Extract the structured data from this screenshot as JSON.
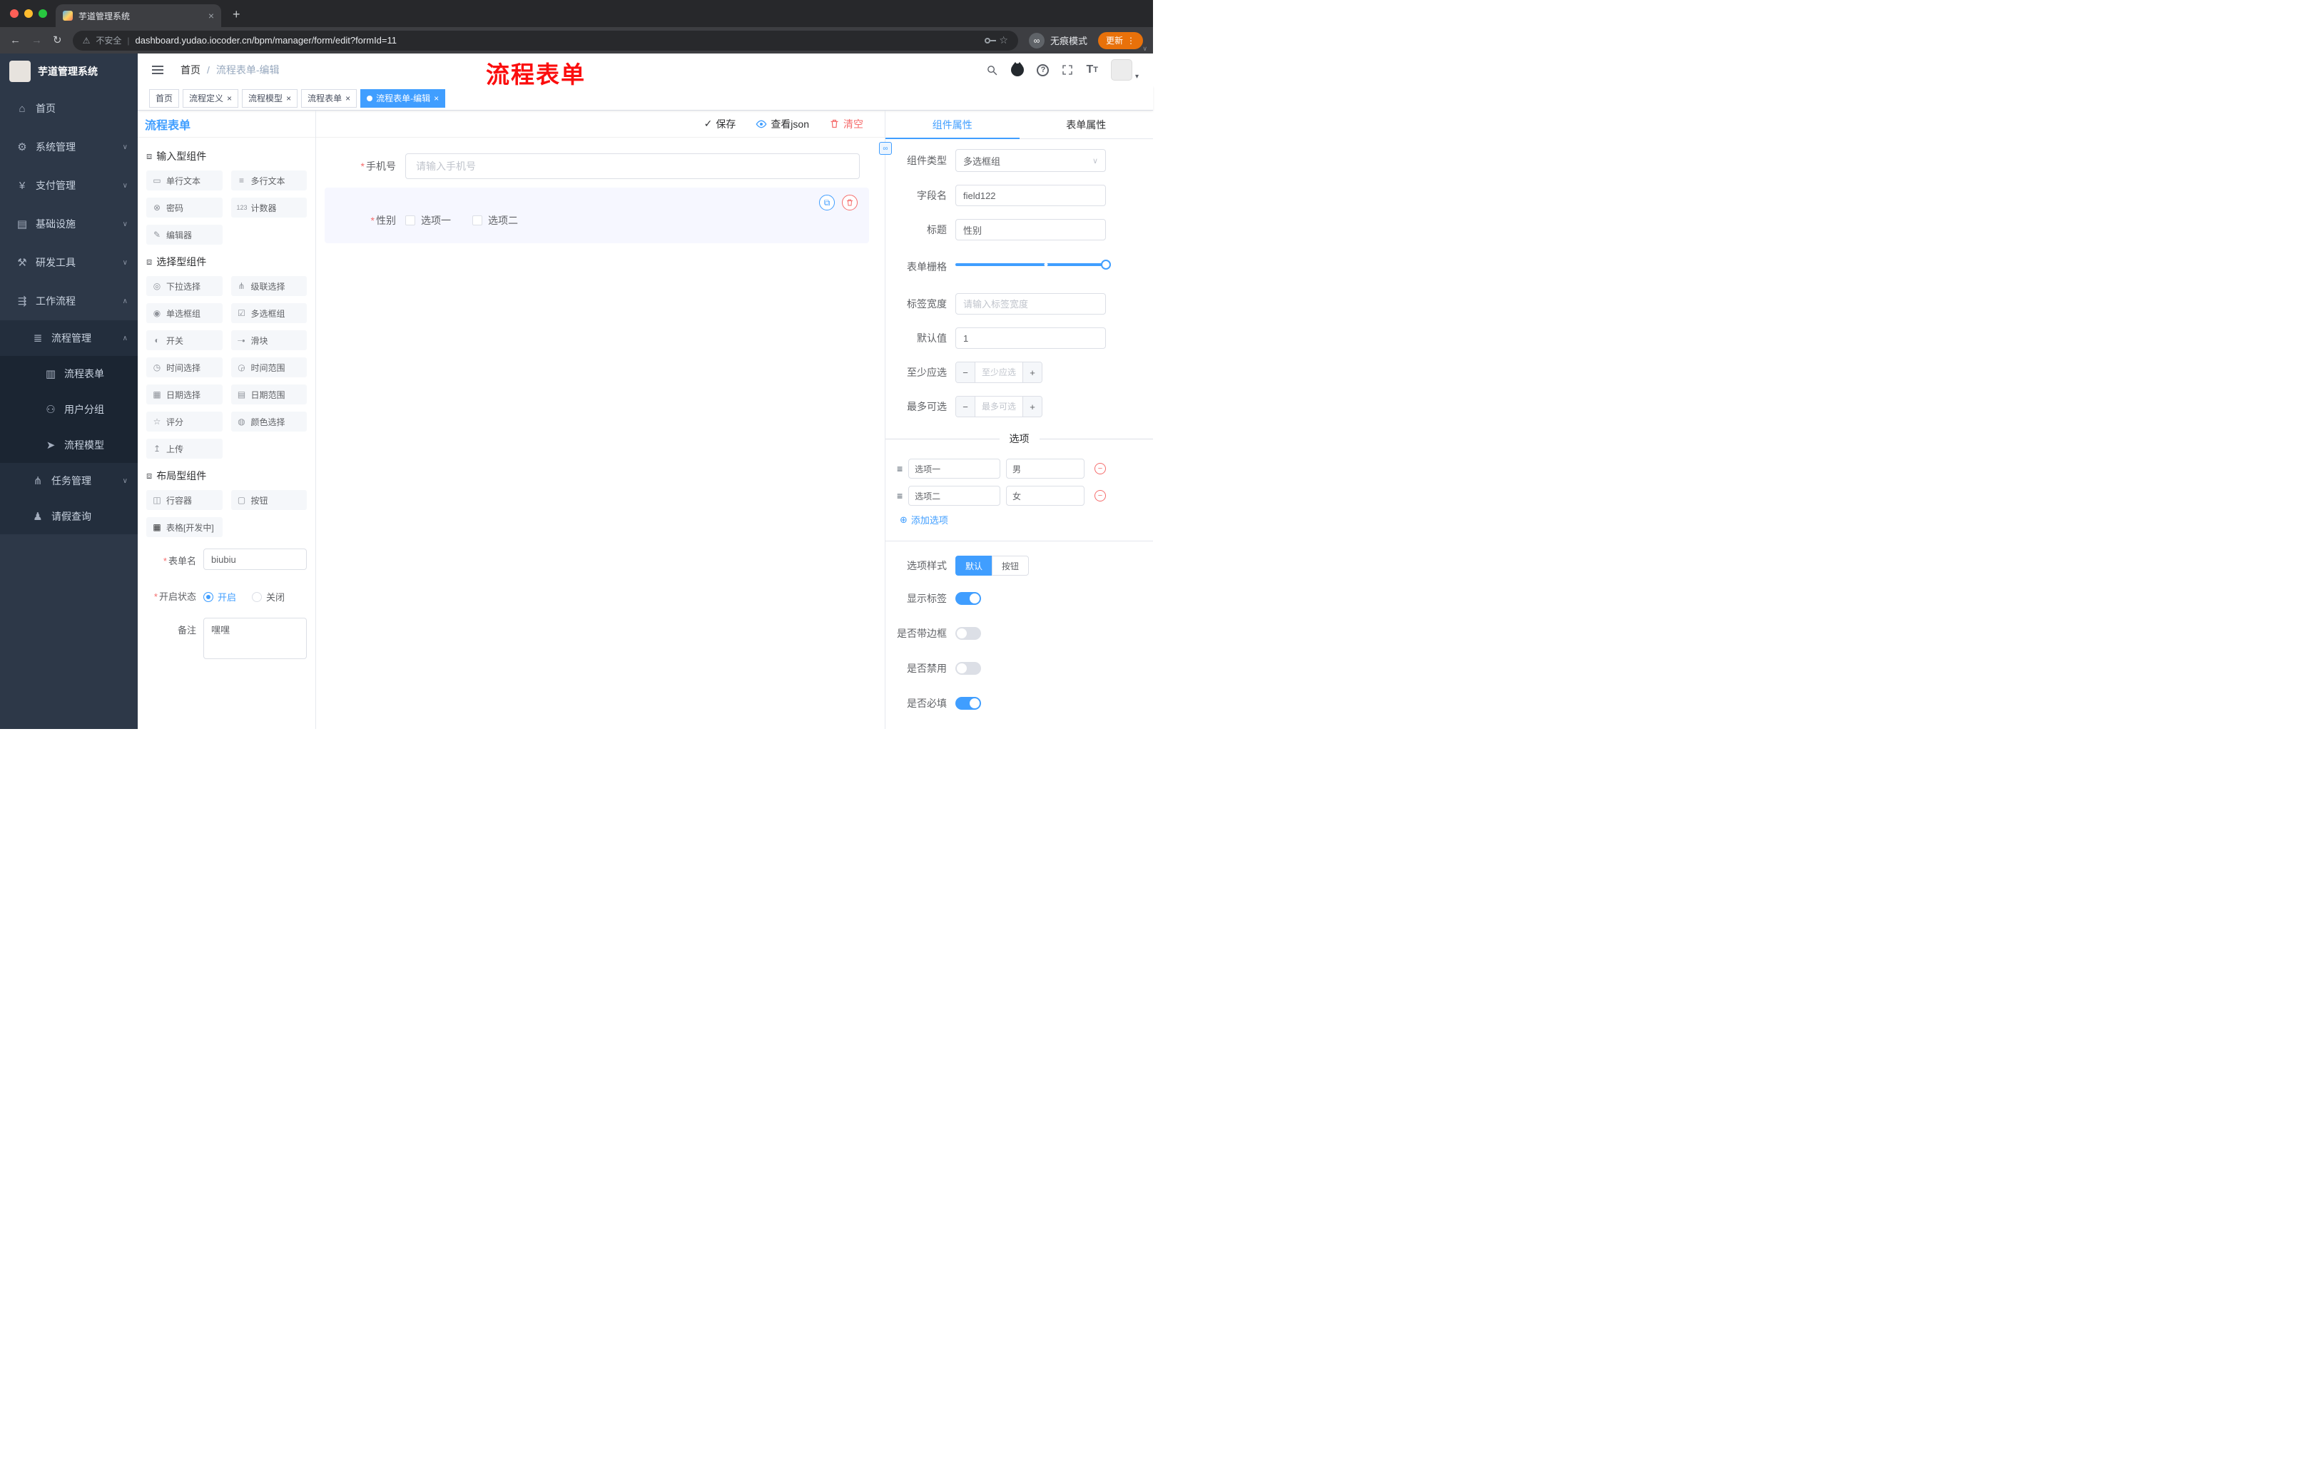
{
  "annotation": {
    "text": "流程表单"
  },
  "colors": {
    "accent": "#409eff",
    "danger": "#f56c6c",
    "annotation_red": "#fb0d0d",
    "update_orange": "#e8710a"
  },
  "icons": {
    "close": "×",
    "plus": "+",
    "back": "←",
    "forward": "→",
    "reload": "↻",
    "warning": "⚠",
    "pipe": "|",
    "star": "☆",
    "glasses": "∞",
    "more": "⋮",
    "chevron_down": "∨",
    "chevron_up": "∧",
    "question": "?",
    "font_big": "T",
    "font_small": "T",
    "caret": "▾",
    "check": "✓",
    "copy": "⧉",
    "link": "∞",
    "add": "⊕",
    "minus": "−",
    "handle": "≡",
    "slash": "/",
    "asterisk": "*"
  },
  "browser": {
    "tab_title": "芋道管理系统",
    "security": "不安全",
    "url": "dashboard.yudao.iocoder.cn/bpm/manager/form/edit?formId=11",
    "incognito": "无痕模式",
    "update": "更新"
  },
  "sidebar": {
    "logo_text": "芋道管理系统",
    "items": [
      {
        "label": "首页",
        "glyph": "⌂"
      },
      {
        "label": "系统管理",
        "glyph": "⚙"
      },
      {
        "label": "支付管理",
        "glyph": "¥"
      },
      {
        "label": "基础设施",
        "glyph": "▤"
      },
      {
        "label": "研发工具",
        "glyph": "⚒"
      },
      {
        "label": "工作流程",
        "glyph": "⇶"
      }
    ],
    "process_mgmt": {
      "label": "流程管理",
      "glyph": "≣"
    },
    "process_children": [
      {
        "label": "流程表单",
        "glyph": "▥"
      },
      {
        "label": "用户分组",
        "glyph": "⚇"
      },
      {
        "label": "流程模型",
        "glyph": "➤"
      }
    ],
    "task_mgmt": {
      "label": "任务管理",
      "glyph": "⋔"
    },
    "leave_query": {
      "label": "请假查询",
      "glyph": "♟"
    }
  },
  "header": {
    "breadcrumb_home": "首页",
    "breadcrumb_current": "流程表单-编辑"
  },
  "tags": [
    {
      "label": "首页"
    },
    {
      "label": "流程定义"
    },
    {
      "label": "流程模型"
    },
    {
      "label": "流程表单"
    },
    {
      "label": "流程表单-编辑"
    }
  ],
  "designer": {
    "panel_title": "流程表单",
    "toolbar": {
      "save": "保存",
      "view_json": "查看json",
      "clear": "清空"
    },
    "palette": {
      "groups": [
        {
          "title": "输入型组件",
          "glyph": "⧈",
          "items": [
            {
              "label": "单行文本",
              "glyph": "▭"
            },
            {
              "label": "多行文本",
              "glyph": "≡"
            },
            {
              "label": "密码",
              "glyph": "⊗"
            },
            {
              "label": "计数器",
              "glyph": "123"
            },
            {
              "label": "编辑器",
              "glyph": "✎"
            }
          ]
        },
        {
          "title": "选择型组件",
          "glyph": "⧈",
          "items": [
            {
              "label": "下拉选择",
              "glyph": "◎"
            },
            {
              "label": "级联选择",
              "glyph": "⋔"
            },
            {
              "label": "单选框组",
              "glyph": "◉"
            },
            {
              "label": "多选框组",
              "glyph": "☑"
            },
            {
              "label": "开关",
              "glyph": "◐"
            },
            {
              "label": "滑块",
              "glyph": "─●"
            },
            {
              "label": "时间选择",
              "glyph": "◷"
            },
            {
              "label": "时间范围",
              "glyph": "◶"
            },
            {
              "label": "日期选择",
              "glyph": "▦"
            },
            {
              "label": "日期范围",
              "glyph": "▤"
            },
            {
              "label": "评分",
              "glyph": "☆"
            },
            {
              "label": "颜色选择",
              "glyph": "◍"
            },
            {
              "label": "上传",
              "glyph": "↥"
            }
          ]
        },
        {
          "title": "布局型组件",
          "glyph": "⧈",
          "items": [
            {
              "label": "行容器",
              "glyph": "◫"
            },
            {
              "label": "按钮",
              "glyph": "▢"
            },
            {
              "label": "表格[开发中]",
              "glyph": "▦"
            }
          ]
        }
      ]
    },
    "meta": {
      "form_name": {
        "label": "表单名",
        "value": "biubiu"
      },
      "status": {
        "label": "开启状态",
        "on": "开启",
        "off": "关闭"
      },
      "remark": {
        "label": "备注",
        "value": "嘿嘿"
      }
    },
    "canvas": {
      "phone": {
        "label": "手机号",
        "placeholder": "请输入手机号"
      },
      "gender": {
        "label": "性别",
        "option1": "选项一",
        "option2": "选项二"
      }
    }
  },
  "props": {
    "tab_component": "组件属性",
    "tab_form": "表单属性",
    "component_type": {
      "label": "组件类型",
      "value": "多选框组"
    },
    "field_name": {
      "label": "字段名",
      "value": "field122"
    },
    "title": {
      "label": "标题",
      "value": "性别"
    },
    "grid": {
      "label": "表单栅格"
    },
    "label_width": {
      "label": "标签宽度",
      "placeholder": "请输入标签宽度"
    },
    "default_value": {
      "label": "默认值",
      "value": "1"
    },
    "min_select": {
      "label": "至少应选",
      "placeholder": "至少应选"
    },
    "max_select": {
      "label": "最多可选",
      "placeholder": "最多可选"
    },
    "options": {
      "divider": "选项",
      "rows": [
        {
          "label": "选项一",
          "value": "男"
        },
        {
          "label": "选项二",
          "value": "女"
        }
      ],
      "add_label": "添加选项"
    },
    "option_style": {
      "label": "选项样式",
      "default": "默认",
      "button": "按钮"
    },
    "switches": [
      {
        "label": "显示标签"
      },
      {
        "label": "是否带边框"
      },
      {
        "label": "是否禁用"
      },
      {
        "label": "是否必填"
      }
    ]
  }
}
